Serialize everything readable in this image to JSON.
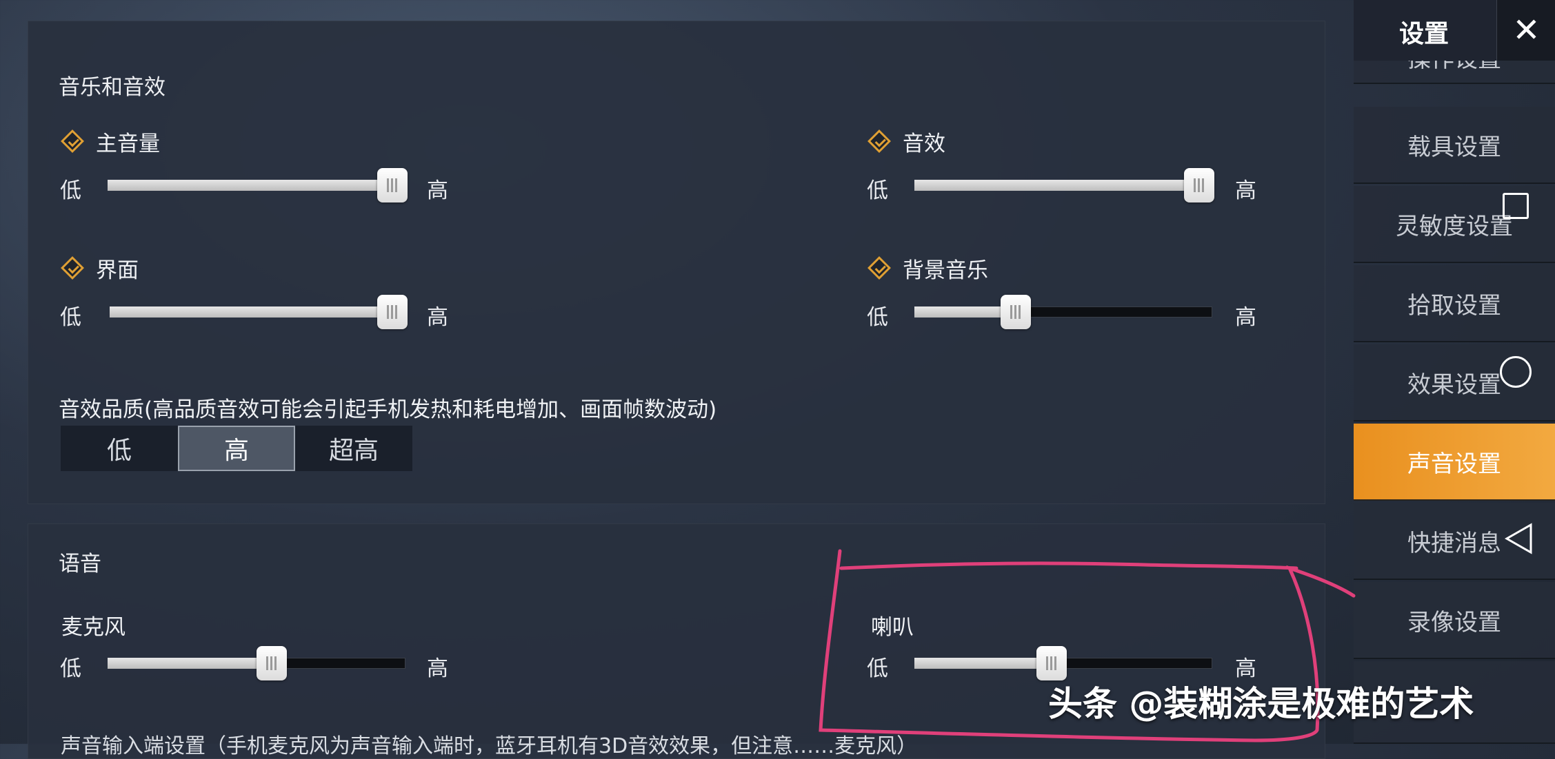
{
  "audio": {
    "section_title": "音乐和音效",
    "low": "低",
    "high": "高",
    "items": [
      {
        "label": "主音量",
        "value": 1.0
      },
      {
        "label": "音效",
        "value": 1.0
      },
      {
        "label": "界面",
        "value": 1.0
      },
      {
        "label": "背景音乐",
        "value": 0.34
      }
    ],
    "quality_label": "音效品质(高品质音效可能会引起手机发热和耗电增加、画面帧数波动)",
    "quality_options": [
      "低",
      "高",
      "超高"
    ],
    "quality_selected": "高"
  },
  "voice": {
    "section_title": "语音",
    "items": [
      {
        "label": "麦克风",
        "value": 0.55
      },
      {
        "label": "喇叭",
        "value": 0.46
      }
    ],
    "input_setting_text": "声音输入端设置（手机麦克风为声音输入端时，蓝牙耳机有3D音效效果，但注意……麦克风）"
  },
  "sidebar": {
    "title": "设置",
    "items": [
      "操作设置",
      "载具设置",
      "灵敏度设置",
      "拾取设置",
      "效果设置",
      "声音设置",
      "快捷消息",
      "录像设置"
    ],
    "active": "声音设置"
  },
  "watermark": "头条 @装糊涂是极难的艺术",
  "colors": {
    "accent": "#f0a035",
    "check": "#e0a034",
    "annotation": "#e0407a"
  }
}
